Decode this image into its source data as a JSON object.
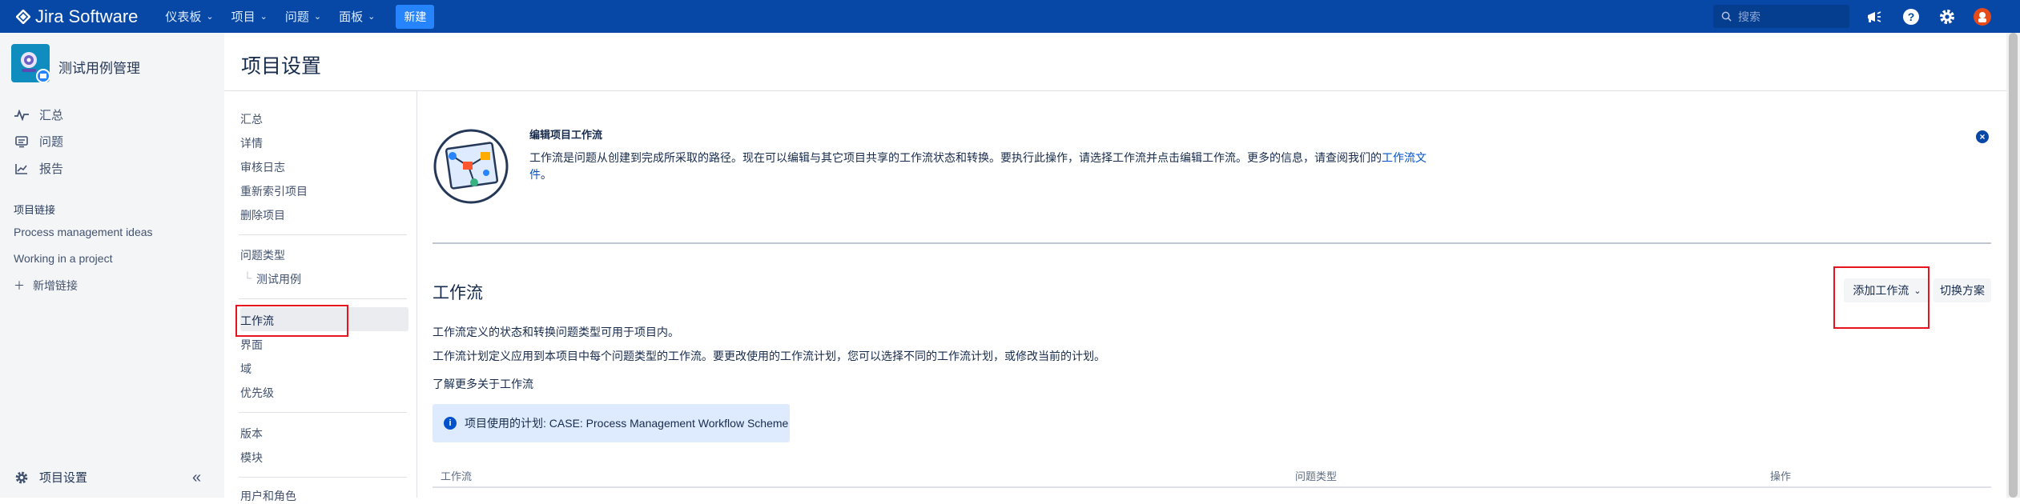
{
  "topbar": {
    "logo_text": "Jira Software",
    "nav": [
      {
        "label": "仪表板"
      },
      {
        "label": "项目"
      },
      {
        "label": "问题"
      },
      {
        "label": "面板"
      }
    ],
    "create_label": "新建",
    "search_placeholder": "搜索"
  },
  "sidebar": {
    "project_name": "测试用例管理",
    "links": [
      {
        "label": "汇总",
        "icon": "pulse-icon"
      },
      {
        "label": "问题",
        "icon": "issues-icon"
      },
      {
        "label": "报告",
        "icon": "chart-icon"
      }
    ],
    "project_links_heading": "项目链接",
    "project_links": [
      "Process management ideas",
      "Working in a project"
    ],
    "add_link_label": "新增链接",
    "settings_label": "项目设置"
  },
  "page": {
    "title": "项目设置"
  },
  "settings_nav": {
    "group1": [
      "汇总",
      "详情",
      "审核日志",
      "重新索引项目",
      "删除项目"
    ],
    "issue_types": "问题类型",
    "issue_type_child": "测试用例",
    "group3": [
      "工作流",
      "界面",
      "域",
      "优先级"
    ],
    "group4": [
      "版本",
      "模块"
    ],
    "group5": "用户和角色"
  },
  "info": {
    "title": "编辑项目工作流",
    "text": "工作流是问题从创建到完成所采取的路径。现在可以编辑与其它项目共享的工作流状态和转换。要执行此操作，请选择工作流并点击编辑工作流。更多的信息，请查阅我们的",
    "link_part1": "工作流文",
    "link_part2": "件",
    "tail": "。"
  },
  "workflow": {
    "title": "工作流",
    "add_button": "添加工作流",
    "switch_button": "切换方案",
    "desc1": "工作流定义的状态和转换问题类型可用于项目内。",
    "desc2": "工作流计划定义应用到本项目中每个问题类型的工作流。要更改使用的工作流计划，您可以选择不同的工作流计划，或修改当前的计划。",
    "learn_more": "了解更多关于工作流",
    "scheme_notice": "项目使用的计划: CASE: Process Management Workflow Scheme",
    "table_headers": [
      "工作流",
      "问题类型",
      "操作"
    ]
  },
  "colors": {
    "topbar": "#0747a6",
    "link": "#0052cc",
    "highlight_box": "#e5141f"
  }
}
